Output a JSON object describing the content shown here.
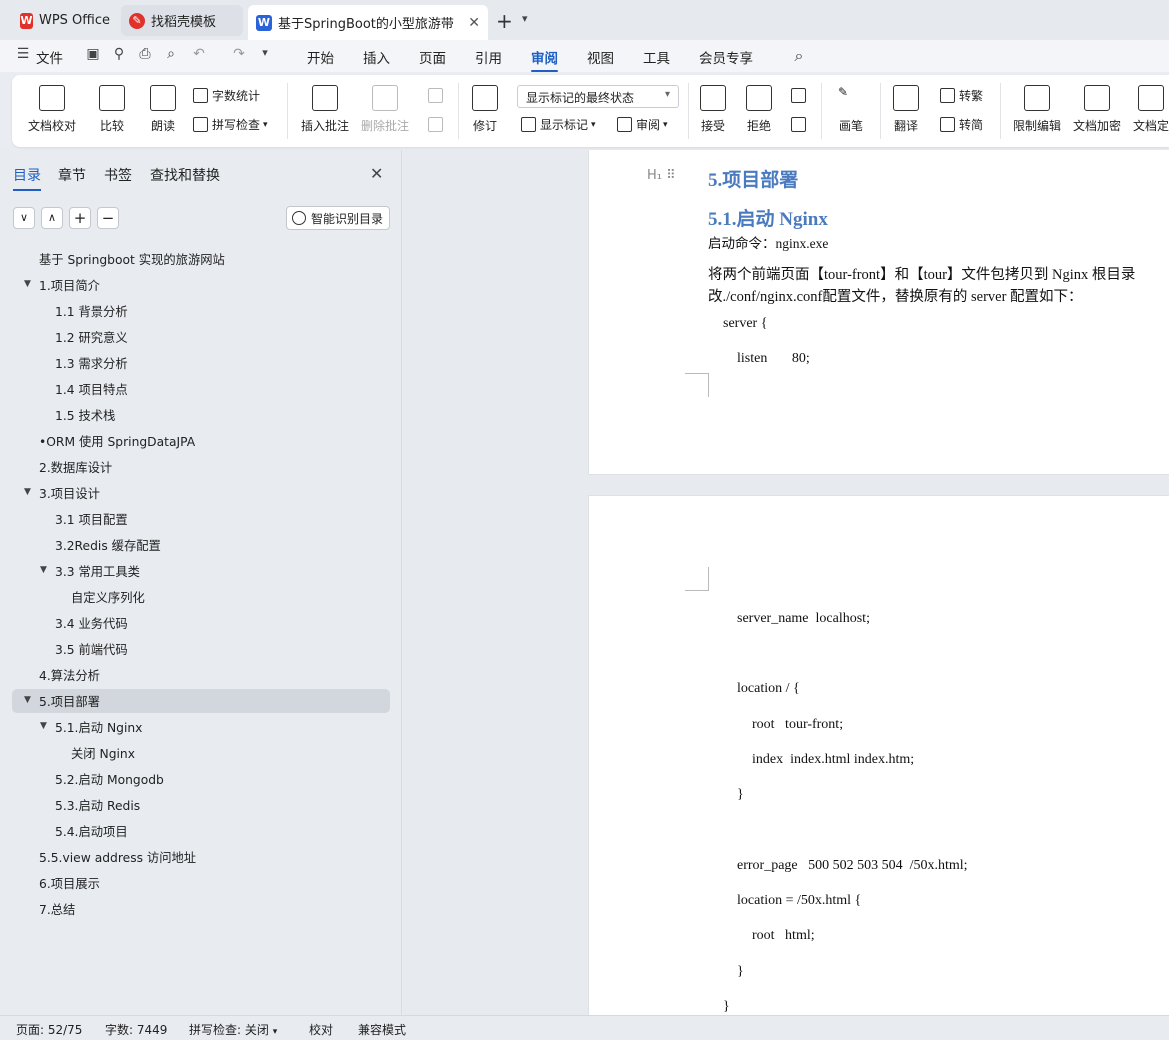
{
  "tabs": [
    {
      "label": "WPS Office",
      "icon": "wps-logo-icon"
    },
    {
      "label": "找稻壳模板",
      "icon": "docer-icon"
    },
    {
      "label": "基于SpringBoot的小型旅游带",
      "icon": "wps-writer-icon"
    }
  ],
  "menu": {
    "file": "文件",
    "items": [
      "开始",
      "插入",
      "页面",
      "引用",
      "审阅",
      "视图",
      "工具",
      "会员专享"
    ],
    "active": "审阅"
  },
  "ribbon": {
    "proofread": "文档校对",
    "compare": "比较",
    "read_aloud": "朗读",
    "word_count": "字数统计",
    "spell_check": "拼写检查",
    "insert_comment": "插入批注",
    "delete_comment": "删除批注",
    "track_changes": "修订",
    "markup_state": "显示标记的最终状态",
    "show_markup": "显示标记",
    "review_pane": "审阅",
    "accept": "接受",
    "reject": "拒绝",
    "ink": "画笔",
    "translate": "翻译",
    "to_traditional": "转繁",
    "to_simplified": "转简",
    "restrict_editing": "限制编辑",
    "encrypt": "文档加密",
    "finalize": "文档定"
  },
  "sidebar": {
    "tabs": [
      "目录",
      "章节",
      "书签",
      "查找和替换"
    ],
    "smart_toc": "智能识别目录",
    "items": [
      {
        "label": "基于 Springboot 实现的旅游网站",
        "level": 0,
        "caret": false
      },
      {
        "label": "1.项目简介",
        "level": 0,
        "caret": true
      },
      {
        "label": "1.1 背景分析",
        "level": 1,
        "caret": false
      },
      {
        "label": "1.2 研究意义",
        "level": 1,
        "caret": false
      },
      {
        "label": "1.3 需求分析",
        "level": 1,
        "caret": false
      },
      {
        "label": "1.4 项目特点",
        "level": 1,
        "caret": false
      },
      {
        "label": "1.5 技术栈",
        "level": 1,
        "caret": false
      },
      {
        "label": "•ORM 使用 SpringDataJPA",
        "level": 0,
        "caret": false
      },
      {
        "label": "2.数据库设计",
        "level": 0,
        "caret": false
      },
      {
        "label": "3.项目设计",
        "level": 0,
        "caret": true
      },
      {
        "label": "3.1 项目配置",
        "level": 1,
        "caret": false
      },
      {
        "label": "3.2Redis 缓存配置",
        "level": 1,
        "caret": false
      },
      {
        "label": "3.3 常用工具类",
        "level": 1,
        "caret": true
      },
      {
        "label": "自定义序列化",
        "level": 2,
        "caret": false
      },
      {
        "label": "3.4 业务代码",
        "level": 1,
        "caret": false
      },
      {
        "label": "3.5 前端代码",
        "level": 1,
        "caret": false
      },
      {
        "label": "4.算法分析",
        "level": 0,
        "caret": false
      },
      {
        "label": "5.项目部署",
        "level": 0,
        "caret": true
      },
      {
        "label": "5.1.启动 Nginx",
        "level": 1,
        "caret": true
      },
      {
        "label": "关闭 Nginx",
        "level": 2,
        "caret": false
      },
      {
        "label": "5.2.启动 Mongodb",
        "level": 1,
        "caret": false
      },
      {
        "label": "5.3.启动 Redis",
        "level": 1,
        "caret": false
      },
      {
        "label": "5.4.启动项目",
        "level": 1,
        "caret": false
      },
      {
        "label": "5.5.view address 访问地址",
        "level": 0,
        "caret": false
      },
      {
        "label": "6.项目展示",
        "level": 0,
        "caret": false
      },
      {
        "label": "7.总结",
        "level": 0,
        "caret": false
      }
    ],
    "selected": "5.项目部署"
  },
  "document": {
    "h1": "5.项目部署",
    "h2": "5.1.启动 Nginx",
    "start_cmd": "启动命令：nginx.exe",
    "para_line1": "将两个前端页面【tour-front】和【tour】文件包拷贝到 Nginx 根目录",
    "para_line2": "改./conf/nginx.conf配置文件，替换原有的 server 配置如下：",
    "page1_code": [
      "server {",
      "listen       80;"
    ],
    "page2_code": [
      "server_name  localhost;",
      "location / {",
      "root   tour-front;",
      "index  index.html index.htm;",
      "}",
      "error_page   500 502 503 504  /50x.html;",
      "location = /50x.html {",
      "root   html;",
      "}",
      "}"
    ]
  },
  "status": {
    "page": "页面: 52/75",
    "words": "字数: 7449",
    "spell": "拼写检查: 关闭",
    "proof": "校对",
    "compat": "兼容模式"
  },
  "colors": {
    "accent": "#1f5fc4",
    "heading": "#4a7ac0",
    "wps_red": "#e0312a"
  }
}
